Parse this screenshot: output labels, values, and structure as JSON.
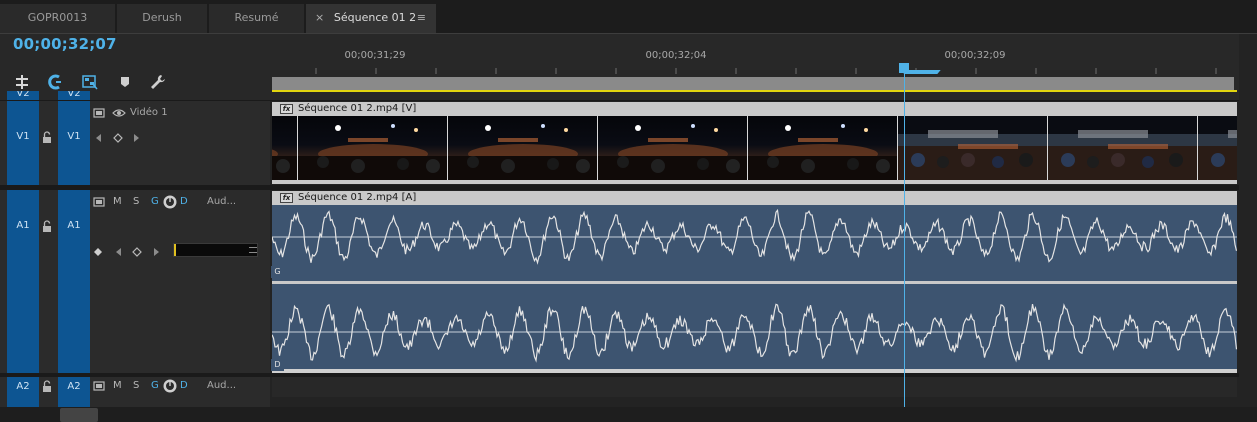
{
  "tabs": [
    {
      "label": "GOPR0013",
      "active": false
    },
    {
      "label": "Derush",
      "active": false
    },
    {
      "label": "Resumé",
      "active": false
    },
    {
      "label": "Séquence 01 2",
      "active": true
    }
  ],
  "tab_close_glyph": "×",
  "tab_menu_glyph": "≡",
  "timecode": "00;00;32;07",
  "ruler": {
    "labels": [
      "00;00;31;29",
      "00;00;32;04",
      "00;00;32;09"
    ]
  },
  "toolbar_icons": [
    "snap-icon",
    "linked-selection-icon",
    "insert-sequence-icon",
    "add-marker-icon",
    "wrench-settings-icon"
  ],
  "tracks": {
    "v2": {
      "label": "V2",
      "target": "V2"
    },
    "v1": {
      "source": "V1",
      "target": "V1",
      "name": "Vidéo 1",
      "clip_title": "Séquence 01 2.mp4 [V]",
      "fx": "fx"
    },
    "a1": {
      "source": "A1",
      "target": "A1",
      "mute": "M",
      "solo": "S",
      "record": "G",
      "voice": "D",
      "name": "Aud...",
      "clip_title": "Séquence 01 2.mp4 [A]",
      "fx": "fx",
      "channels": [
        "G",
        "D"
      ]
    },
    "a2": {
      "source": "A2",
      "target": "A2",
      "mute": "M",
      "solo": "S",
      "record": "G",
      "voice": "D",
      "name": "Aud..."
    }
  },
  "colors": {
    "accent": "#4fb2e8",
    "track_target": "#0d5592",
    "audio_clip": "#3d5470",
    "work_area": "#e2d60f"
  }
}
